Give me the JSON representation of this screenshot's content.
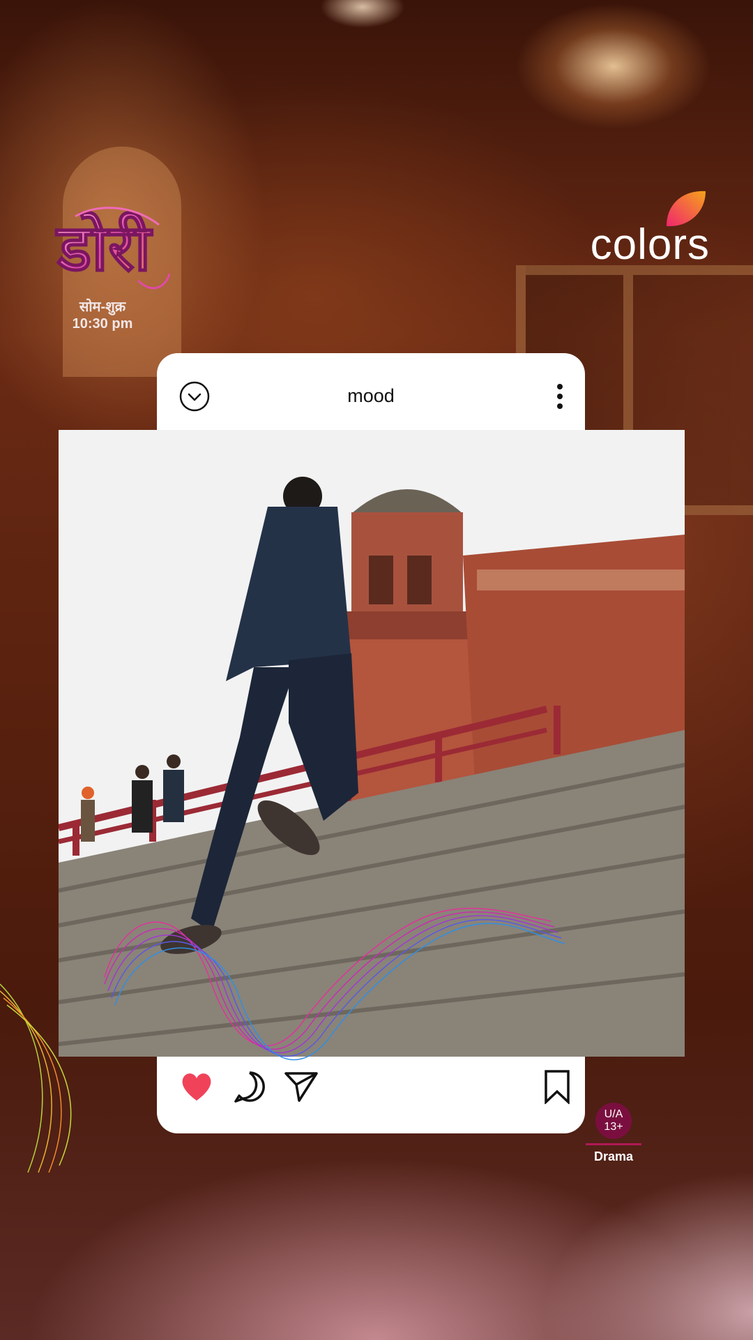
{
  "show": {
    "logo_text": "डोरी",
    "days": "सोम-शुक्र",
    "time": "10:30 pm"
  },
  "channel": {
    "name": "colors"
  },
  "post": {
    "title": "mood",
    "liked": true
  },
  "rating": {
    "line1": "U/A",
    "line2": "13+",
    "genre": "Drama"
  },
  "icons": {
    "collapse": "chevron-down-circle-icon",
    "more": "more-vertical-icon",
    "like": "heart-icon",
    "comment": "comment-icon",
    "share": "send-icon",
    "save": "bookmark-icon"
  },
  "colors": {
    "like": "#f0435a",
    "channel_leaf_start": "#f0266e",
    "channel_leaf_end": "#f6a21a",
    "rating_badge": "#7a0f3f"
  }
}
